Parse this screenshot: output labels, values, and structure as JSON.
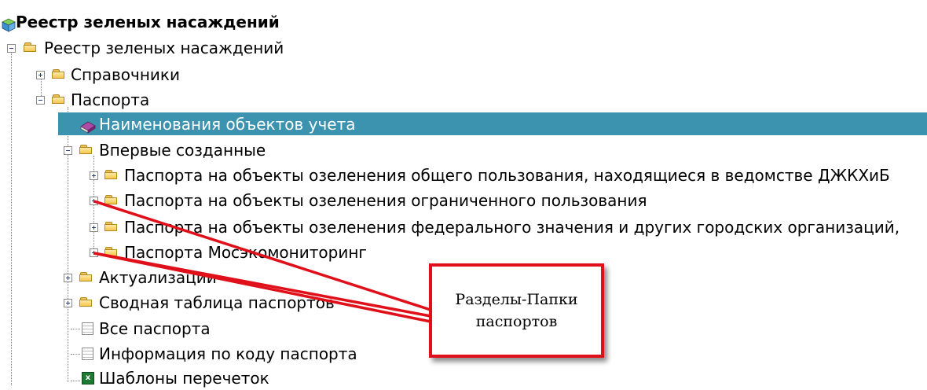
{
  "tree": {
    "root_title": "Реестр зеленых насаждений",
    "items": [
      {
        "label": "Реестр зеленых насаждений"
      },
      {
        "label": "Справочники"
      },
      {
        "label": "Паспорта"
      },
      {
        "label": "Наименования объектов учета"
      },
      {
        "label": "Впервые созданные"
      },
      {
        "label": "Паспорта на объекты озеленения общего пользования, находящиеся в ведомстве ДЖКХиБ"
      },
      {
        "label": "Паспорта на объекты озеленения ограниченного пользования"
      },
      {
        "label": "Паспорта на объекты озеленения федерального значения и других городских организаций,"
      },
      {
        "label": "Паспорта Мосэкомониторинг"
      },
      {
        "label": "Актуализации"
      },
      {
        "label": "Сводная таблица паспортов"
      },
      {
        "label": "Все паспорта"
      },
      {
        "label": "Информация по коду паспорта"
      },
      {
        "label": "Шаблоны перечеток"
      }
    ]
  },
  "callout": {
    "line1": "Разделы-Папки",
    "line2": "паспортов",
    "color": "#e0101b"
  },
  "selection_color": "#3b93b0",
  "icons": {
    "root": "cube-icon",
    "folder": "folder-icon",
    "object_names": "book-icon",
    "document": "document-icon",
    "templates": "excel-icon"
  }
}
